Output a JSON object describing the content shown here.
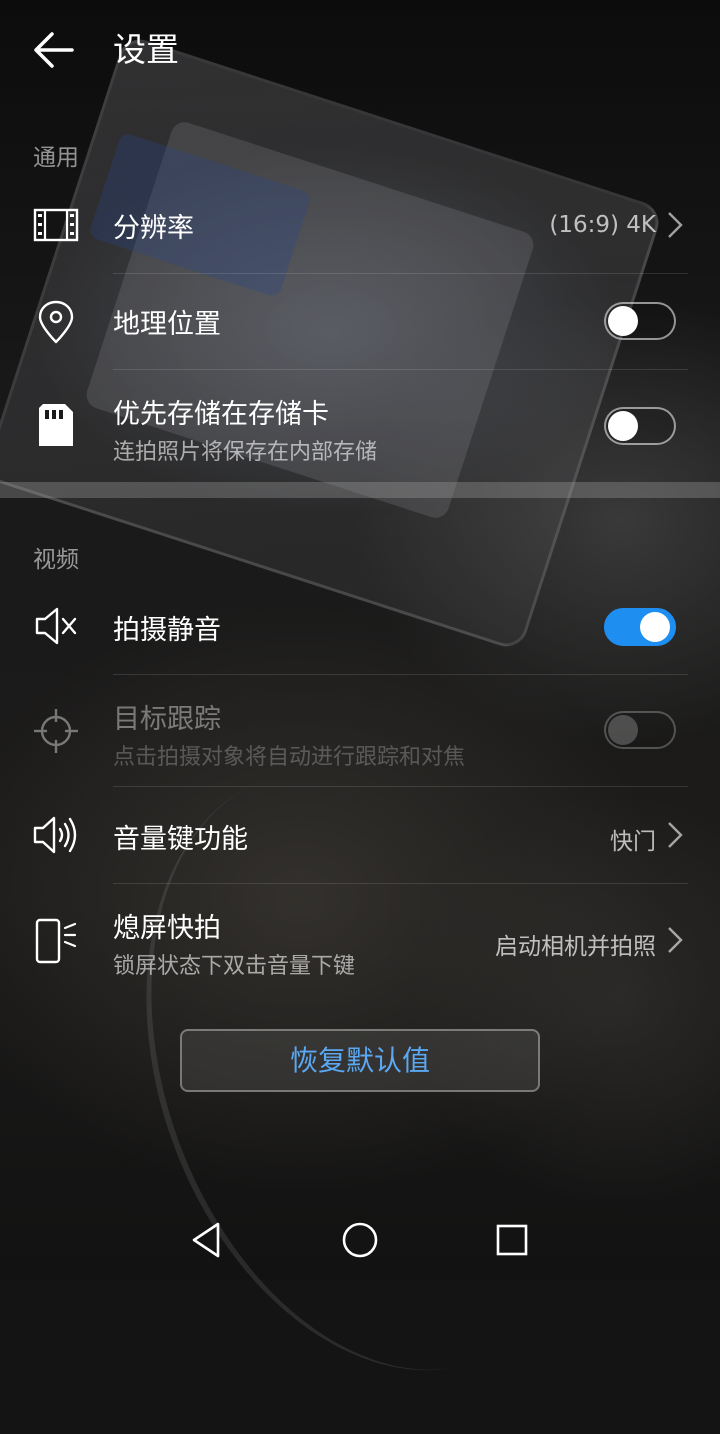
{
  "header": {
    "title": "设置",
    "back_icon": "arrow-left-icon"
  },
  "sections": {
    "general": {
      "title": "通用",
      "resolution": {
        "label": "分辨率",
        "value": "(16:9) 4K",
        "icon": "film-icon"
      },
      "location": {
        "label": "地理位置",
        "icon": "location-pin-icon",
        "switch_on": false
      },
      "sd_storage": {
        "label": "优先存储在存储卡",
        "sub": "连拍照片将保存在内部存储",
        "icon": "sd-card-icon",
        "switch_on": false
      }
    },
    "video": {
      "title": "视频",
      "mute": {
        "label": "拍摄静音",
        "icon": "speaker-mute-icon",
        "switch_on": true
      },
      "tracking": {
        "label": "目标跟踪",
        "sub": "点击拍摄对象将自动进行跟踪和对焦",
        "icon": "crosshair-icon",
        "switch_on": false,
        "disabled": true
      },
      "volume_key": {
        "label": "音量键功能",
        "value": "快门",
        "icon": "speaker-volume-icon"
      },
      "snapshot": {
        "label": "熄屏快拍",
        "sub": "锁屏状态下双击音量下键",
        "value": "启动相机并拍照",
        "icon": "phone-snapshot-icon"
      }
    }
  },
  "restore_button": {
    "label": "恢复默认值"
  },
  "navbar": {
    "back_icon": "triangle-back-icon",
    "home_icon": "circle-home-icon",
    "recents_icon": "square-recents-icon"
  },
  "colors": {
    "accent": "#1e8ff0",
    "restore_text": "#5aa8f2"
  }
}
